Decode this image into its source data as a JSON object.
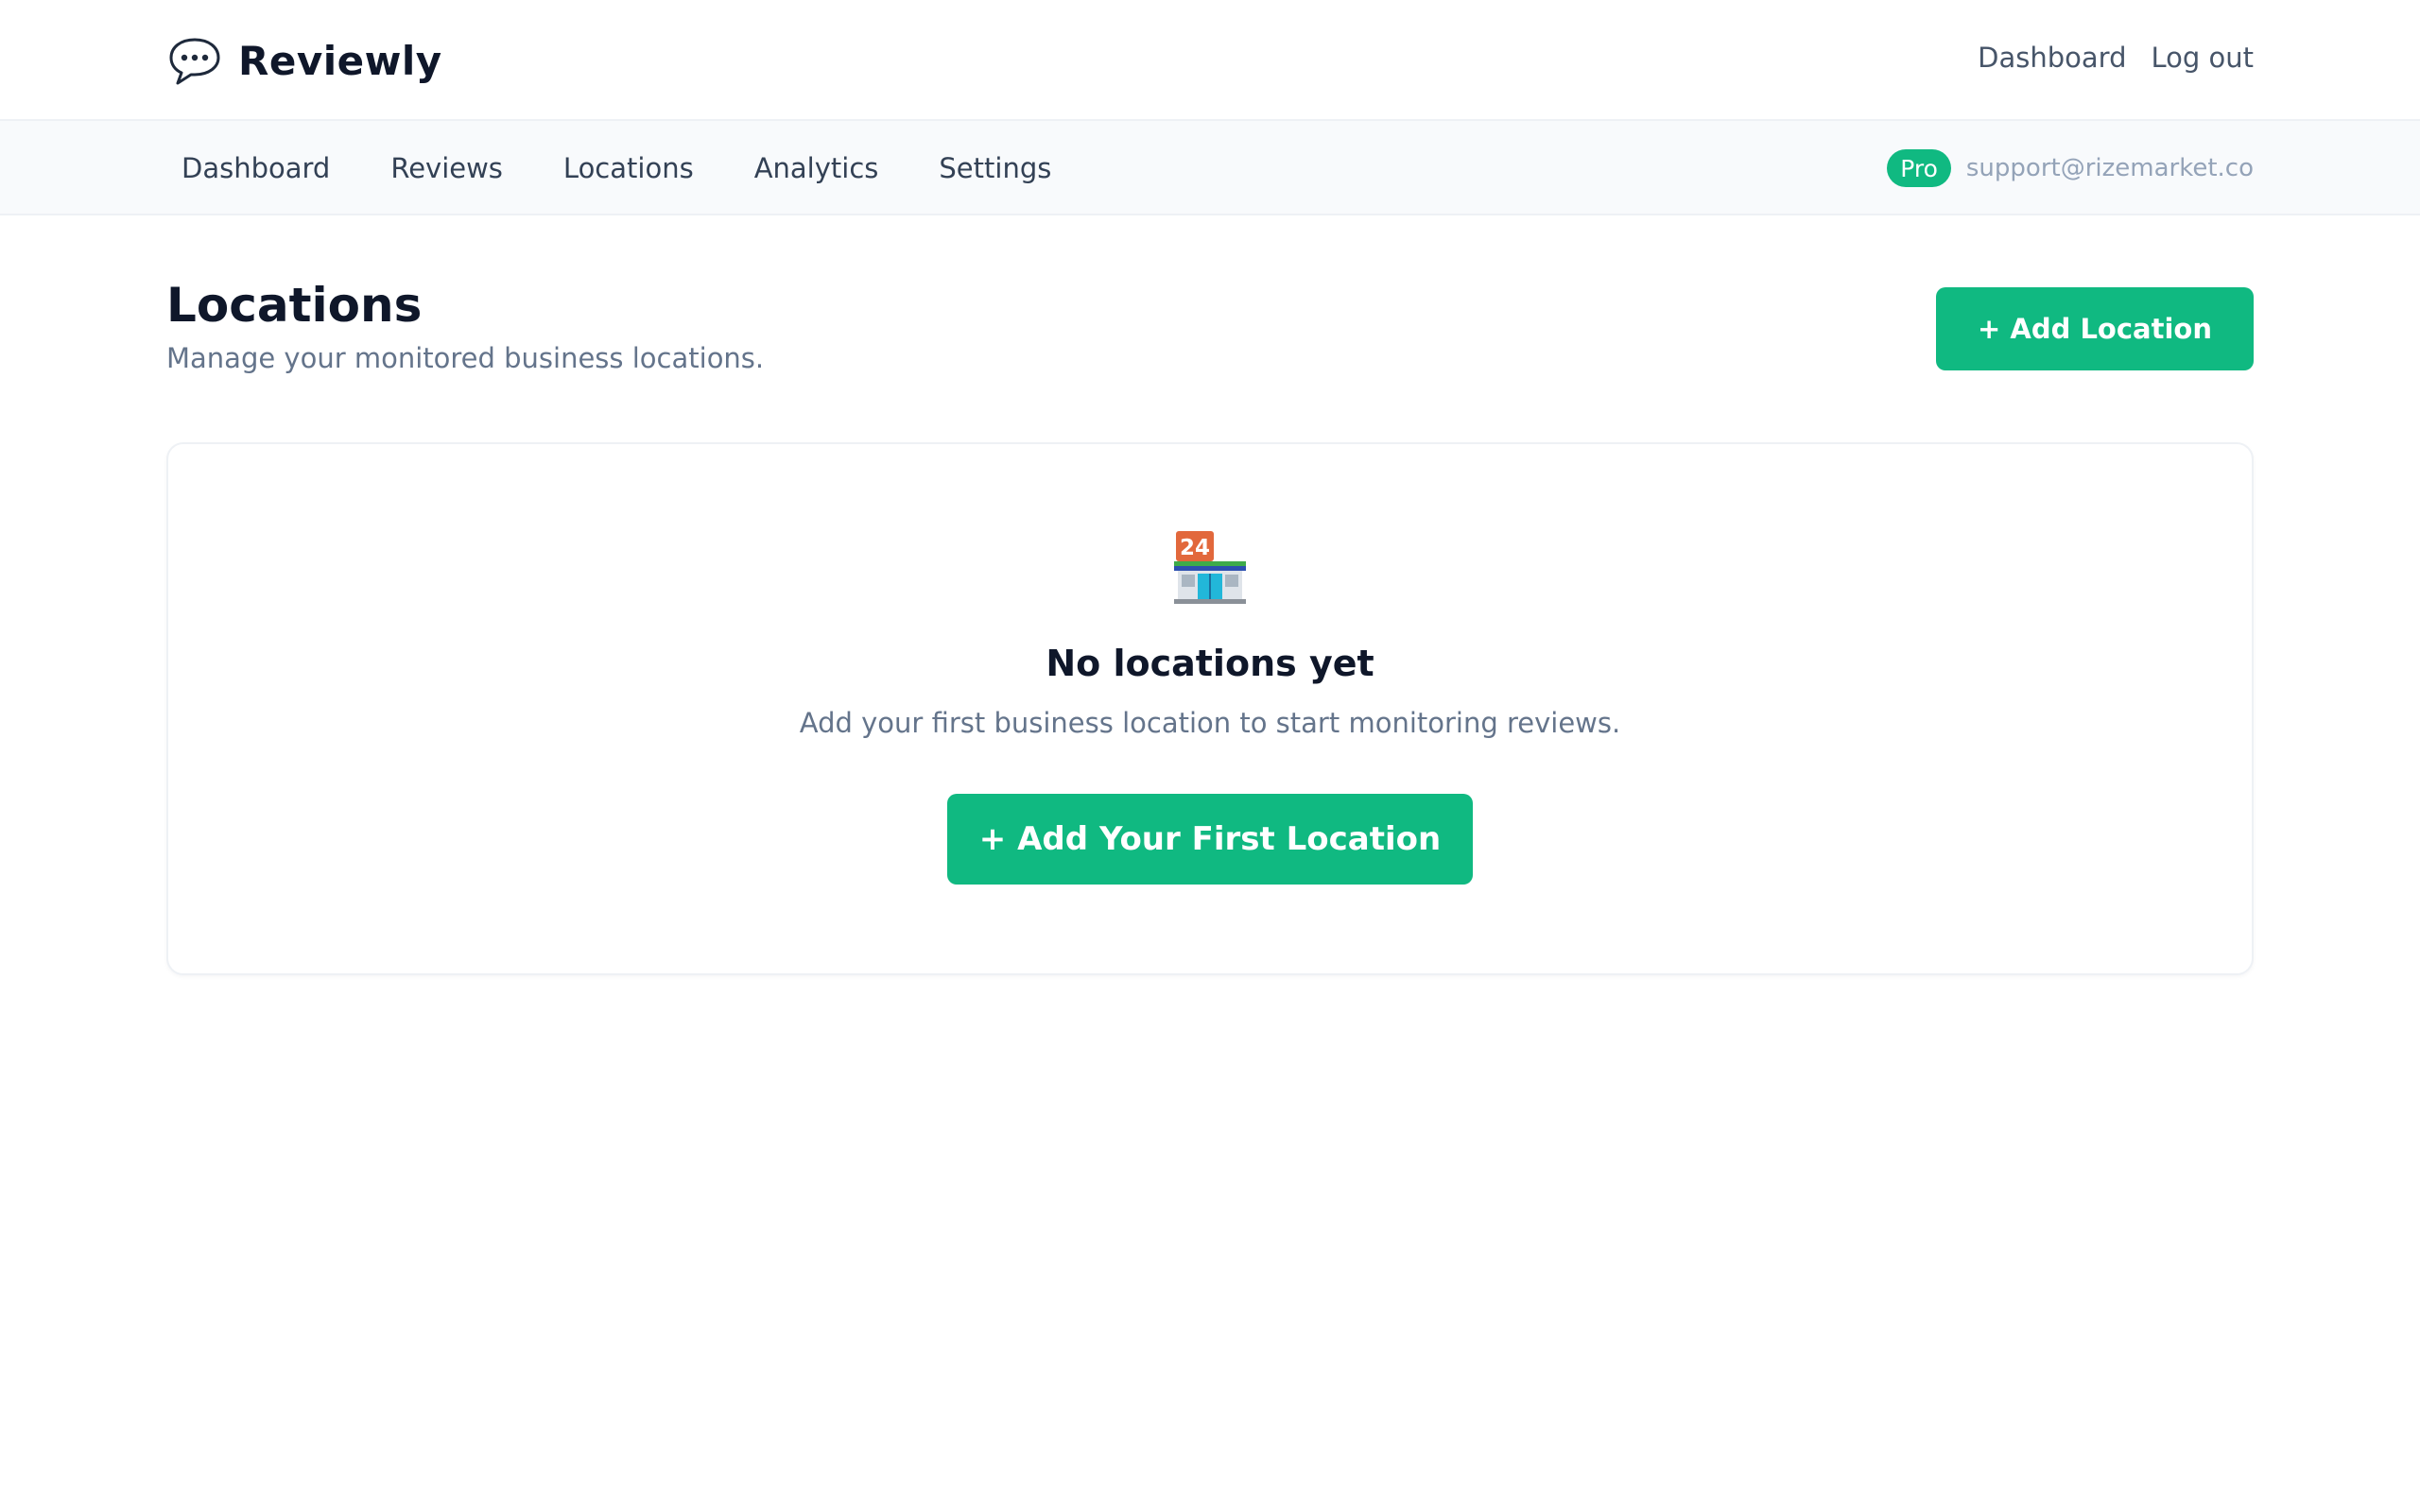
{
  "brand": {
    "name": "Reviewly",
    "icon": "speech-bubble-icon"
  },
  "top_links": [
    "Dashboard",
    "Log out"
  ],
  "subnav": {
    "items": [
      "Dashboard",
      "Reviews",
      "Locations",
      "Analytics",
      "Settings"
    ],
    "plan_badge": "Pro",
    "email": "support@rizemarket.co"
  },
  "page": {
    "title": "Locations",
    "subtitle": "Manage your monitored business locations.",
    "add_button": "+ Add Location"
  },
  "empty_state": {
    "icon": "convenience-store-icon",
    "title": "No locations yet",
    "description": "Add your first business location to start monitoring reviews.",
    "button": "+ Add Your First Location"
  },
  "colors": {
    "accent": "#10b981",
    "text": "#0f172a",
    "muted": "#64748b"
  }
}
